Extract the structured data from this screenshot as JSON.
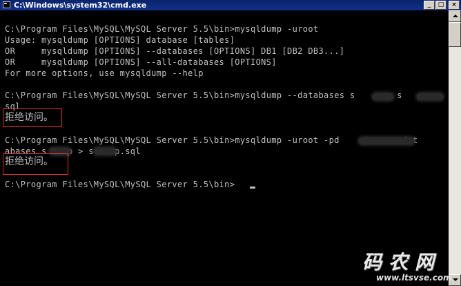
{
  "window": {
    "title": "C:\\Windows\\system32\\cmd.exe",
    "icon": "cmd-icon",
    "buttons": {
      "minimize": "_",
      "maximize": "□",
      "close": "×"
    }
  },
  "console": {
    "lines": [
      "C:\\Program Files\\MySQL\\MySQL Server 5.5\\bin>mysqldump -uroot",
      "Usage: mysqldump [OPTIONS] database [tables]",
      "OR     mysqldump [OPTIONS] --databases [OPTIONS] DB1 [DB2 DB3...]",
      "OR     mysqldump [OPTIONS] --all-databases [OPTIONS]",
      "For more options, use mysqldump --help",
      "",
      "C:\\Program Files\\MySQL\\MySQL Server 5.5\\bin>mysqldump --databases s    p > s    p.",
      "sql",
      "拒绝访问。",
      "",
      "C:\\Program Files\\MySQL\\MySQL Server 5.5\\bin>mysqldump -uroot -pd          --dat",
      "abases s    p > s    p.sql",
      "拒绝访问。",
      "",
      "C:\\Program Files\\MySQL\\MySQL Server 5.5\\bin>"
    ]
  },
  "watermark": {
    "site_name": "码农网",
    "url": "www.ltsvse.com"
  },
  "colors": {
    "console_bg": "#000000",
    "console_fg": "#c0c0c0",
    "titlebar": "#0a246a",
    "highlight": "#dd3333"
  }
}
